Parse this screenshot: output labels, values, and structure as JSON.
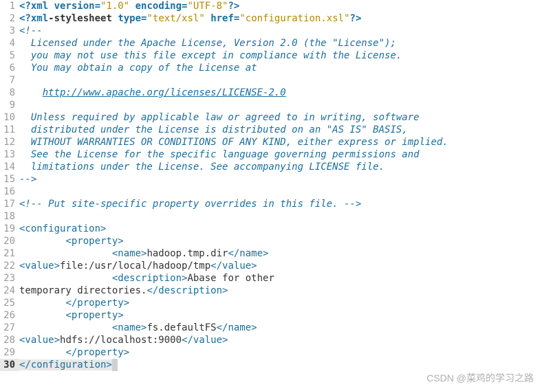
{
  "watermark": "CSDN @菜鸡的学习之路",
  "lines": [
    {
      "n": 1
    },
    {
      "n": 2
    },
    {
      "n": 3
    },
    {
      "n": 4
    },
    {
      "n": 5
    },
    {
      "n": 6
    },
    {
      "n": 7
    },
    {
      "n": 8
    },
    {
      "n": 9
    },
    {
      "n": 10
    },
    {
      "n": 11
    },
    {
      "n": 12
    },
    {
      "n": 13
    },
    {
      "n": 14
    },
    {
      "n": 15
    },
    {
      "n": 16
    },
    {
      "n": 17
    },
    {
      "n": 18
    },
    {
      "n": 19
    },
    {
      "n": 20
    },
    {
      "n": 21
    },
    {
      "n": 22
    },
    {
      "n": 23
    },
    {
      "n": 24
    },
    {
      "n": 25
    },
    {
      "n": 26
    },
    {
      "n": 27
    },
    {
      "n": 28
    },
    {
      "n": 29
    },
    {
      "n": 30
    }
  ],
  "l1": {
    "open": "<?",
    "xml": "xml ",
    "ver_attr": "version=",
    "ver_val": "\"1.0\"",
    "sp": " ",
    "enc_attr": "encoding=",
    "enc_val": "\"UTF-8\"",
    "close": "?>"
  },
  "l2": {
    "open": "<?",
    "xml": "xml",
    "dash": "-stylesheet ",
    "type_attr": "type=",
    "type_val": "\"text/xsl\"",
    "sp": " ",
    "href_attr": "href=",
    "href_val": "\"configuration.xsl\"",
    "close": "?>"
  },
  "l3": {
    "text": "<!--"
  },
  "l4": {
    "text": "  Licensed under the Apache License, Version 2.0 (the \"License\");"
  },
  "l5": {
    "text": "  you may not use this file except in compliance with the License."
  },
  "l6": {
    "text": "  You may obtain a copy of the License at"
  },
  "l7": {
    "text": ""
  },
  "l8": {
    "indent": "    ",
    "url": "http://www.apache.org/licenses/LICENSE-2.0"
  },
  "l9": {
    "text": ""
  },
  "l10": {
    "text": "  Unless required by applicable law or agreed to in writing, software"
  },
  "l11": {
    "text": "  distributed under the License is distributed on an \"AS IS\" BASIS,"
  },
  "l12": {
    "text": "  WITHOUT WARRANTIES OR CONDITIONS OF ANY KIND, either express or implied."
  },
  "l13": {
    "text": "  See the License for the specific language governing permissions and"
  },
  "l14": {
    "text": "  limitations under the License. See accompanying LICENSE file."
  },
  "l15": {
    "text": "-->"
  },
  "l16": {
    "text": ""
  },
  "l17": {
    "text": "<!-- Put site-specific property overrides in this file. -->"
  },
  "l18": {
    "text": ""
  },
  "l19": {
    "tag": "<configuration>"
  },
  "l20": {
    "indent": "        ",
    "tag": "<property>"
  },
  "l21": {
    "indent": "                ",
    "open": "<name>",
    "val": "hadoop.tmp.dir",
    "close": "</name>"
  },
  "l22": {
    "open": "<value>",
    "val": "file:/usr/local/hadoop/tmp",
    "close": "</value>"
  },
  "l23": {
    "indent": "                ",
    "open": "<description>",
    "val": "Abase for other"
  },
  "l24": {
    "val": "temporary directories.",
    "close": "</description>"
  },
  "l25": {
    "indent": "        ",
    "tag": "</property>"
  },
  "l26": {
    "indent": "        ",
    "tag": "<property>"
  },
  "l27": {
    "indent": "                ",
    "open": "<name>",
    "val": "fs.defaultFS",
    "close": "</name>"
  },
  "l28": {
    "open": "<value>",
    "val": "hdfs://localhost:9000",
    "close": "</value>"
  },
  "l29": {
    "indent": "        ",
    "tag": "</property>"
  },
  "l30": {
    "tag": "</configuration>"
  }
}
